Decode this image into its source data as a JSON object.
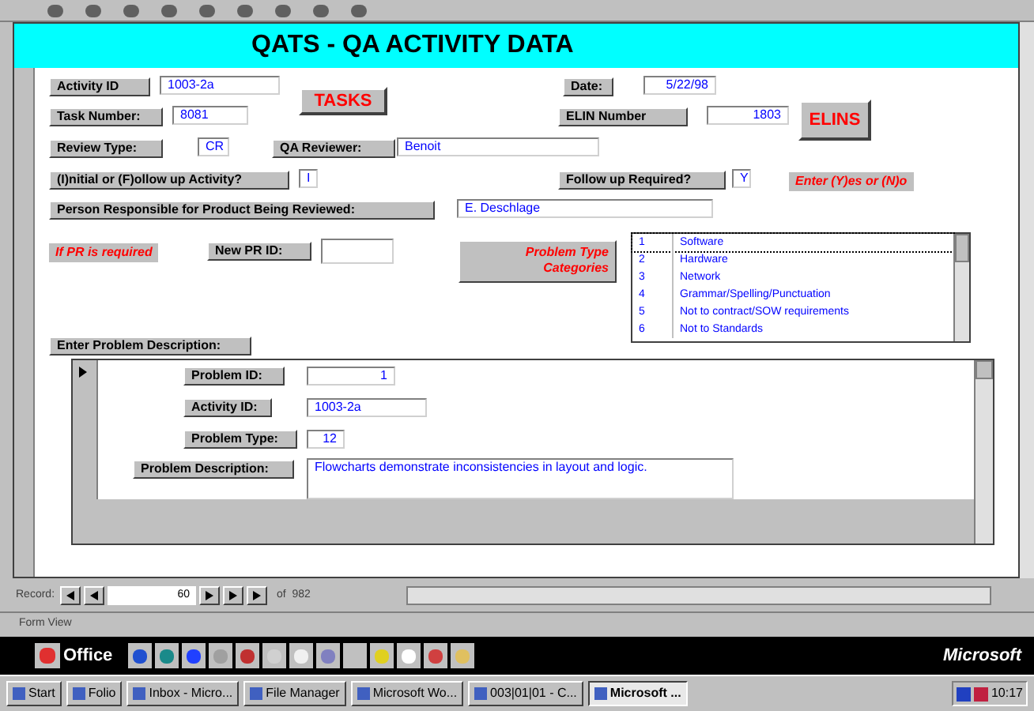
{
  "form_title": "QATS - QA ACTIVITY DATA",
  "activity_id": {
    "label": "Activity ID",
    "value": "1003-2a"
  },
  "task_number": {
    "label": "Task Number:",
    "value": "8081"
  },
  "tasks_button": "TASKS",
  "date": {
    "label": "Date:",
    "value": "5/22/98"
  },
  "elin_number": {
    "label": "ELIN Number",
    "value": "1803"
  },
  "elins_button": "ELINS",
  "review_type": {
    "label": "Review Type:",
    "value": "CR"
  },
  "qa_reviewer": {
    "label": "QA Reviewer:",
    "value": "Benoit"
  },
  "initial_or_followup": {
    "label": "(I)nitial or (F)ollow up Activity?",
    "value": "I"
  },
  "follow_up_required": {
    "label": "Follow up Required?",
    "value": "Y"
  },
  "yes_no_hint": "Enter (Y)es or (N)o",
  "person_responsible": {
    "label": "Person Responsible for Product Being Reviewed:",
    "value": "E. Deschlage"
  },
  "pr_required_note": "If PR is required",
  "new_pr_id": {
    "label": "New PR ID:"
  },
  "problem_type_categories": "Problem Type Categories",
  "categories": [
    {
      "number": "1",
      "name": "Software",
      "selected": true
    },
    {
      "number": "2",
      "name": "Hardware",
      "selected": false
    },
    {
      "number": "3",
      "name": "Network",
      "selected": false
    },
    {
      "number": "4",
      "name": "Grammar/Spelling/Punctuation",
      "selected": false
    },
    {
      "number": "5",
      "name": "Not to contract/SOW requirements",
      "selected": false
    },
    {
      "number": "6",
      "name": "Not to Standards",
      "selected": false
    }
  ],
  "problem_section_label": "Enter Problem Description:",
  "problem": {
    "problem_id": {
      "label": "Problem ID:",
      "value": "1"
    },
    "activity_id": {
      "label": "Activity ID:",
      "value": "1003-2a"
    },
    "problem_type": {
      "label": "Problem Type:",
      "value": "12"
    },
    "description": {
      "label": "Problem Description:",
      "value": "Flowcharts demonstrate inconsistencies in layout and logic."
    }
  },
  "record_nav": {
    "label": "Record:",
    "current": "60",
    "total": "of  982"
  },
  "status_bar": "Form View",
  "office_bar": {
    "label": "Office",
    "brand": "Microsoft"
  },
  "taskbar": [
    {
      "label": "Start",
      "selected": false
    },
    {
      "label": "Folio",
      "selected": false
    },
    {
      "label": "Inbox - Micro...",
      "selected": false
    },
    {
      "label": "File Manager",
      "selected": false
    },
    {
      "label": "Microsoft Wo...",
      "selected": false
    },
    {
      "label": "003|01|01 - C...",
      "selected": false
    },
    {
      "label": "Microsoft ...",
      "selected": true
    }
  ],
  "clock": "10:17"
}
